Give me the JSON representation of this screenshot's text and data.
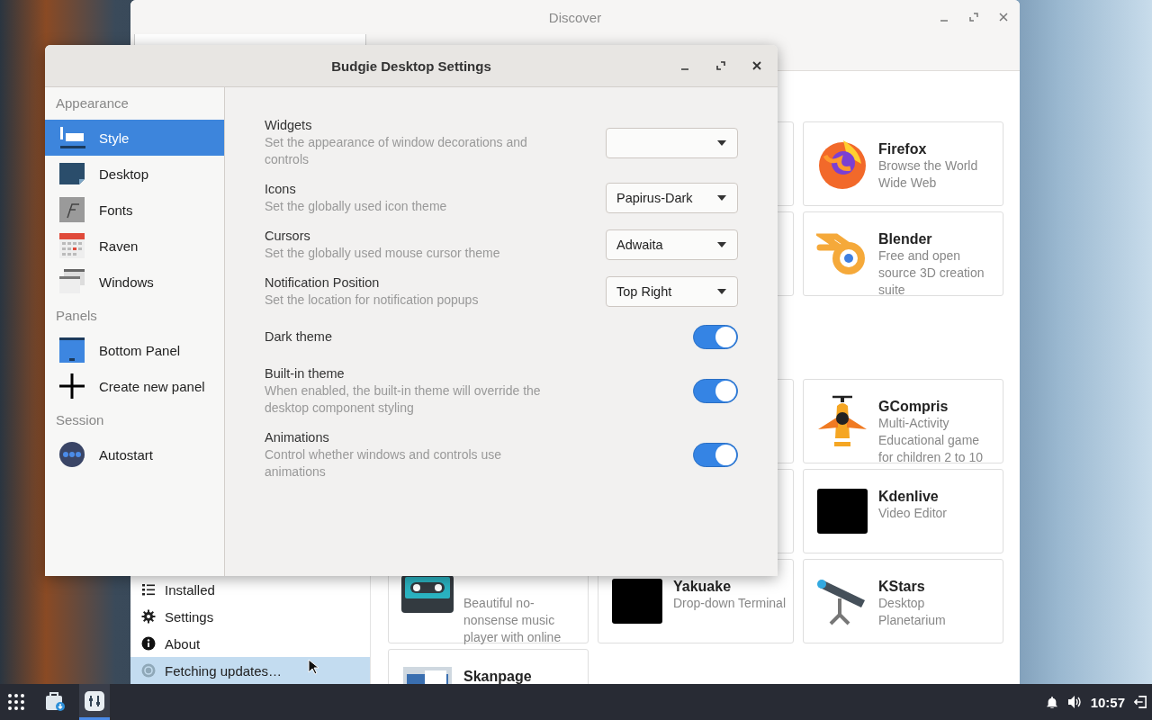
{
  "discover": {
    "title": "Discover",
    "sidebar": [
      {
        "label": "Installed",
        "selected": false
      },
      {
        "label": "Settings",
        "selected": false
      },
      {
        "label": "About",
        "selected": false
      },
      {
        "label": "Fetching updates…",
        "selected": true
      }
    ],
    "sections": [
      {
        "cards": [
          {
            "kind": "spacer"
          },
          {
            "kind": "blank"
          },
          {
            "kind": "app",
            "name": "Firefox",
            "description": "Browse the World Wide Web"
          },
          {
            "kind": "spacer"
          },
          {
            "kind": "blank"
          },
          {
            "kind": "app",
            "name": "Blender",
            "description": "Free and open source 3D creation suite"
          }
        ]
      },
      {
        "cards": [
          {
            "kind": "spacer"
          },
          {
            "kind": "blank"
          },
          {
            "kind": "app",
            "name": "GCompris",
            "description": "Multi-Activity Educational game for children 2 to 10"
          },
          {
            "kind": "spacer"
          },
          {
            "kind": "blank"
          },
          {
            "kind": "app",
            "name": "Kdenlive",
            "description": "Video Editor"
          },
          {
            "kind": "app",
            "description": "Beautiful no-nonsense music player with online"
          },
          {
            "kind": "app",
            "name": "Yakuake",
            "description": "Drop-down Terminal"
          },
          {
            "kind": "app",
            "name": "KStars",
            "description": "Desktop Planetarium"
          },
          {
            "kind": "app",
            "name": "Skanpage"
          }
        ]
      }
    ]
  },
  "settings_window": {
    "title": "Budgie Desktop Settings",
    "sidebar": [
      {
        "header": "Appearance",
        "items": [
          {
            "label": "Style",
            "selected": true
          },
          {
            "label": "Desktop",
            "selected": false
          },
          {
            "label": "Fonts",
            "selected": false
          },
          {
            "label": "Raven",
            "selected": false
          },
          {
            "label": "Windows",
            "selected": false
          }
        ]
      },
      {
        "header": "Panels",
        "items": [
          {
            "label": "Bottom Panel",
            "selected": false
          },
          {
            "label": "Create new panel",
            "selected": false
          }
        ]
      },
      {
        "header": "Session",
        "items": [
          {
            "label": "Autostart",
            "selected": false
          }
        ]
      }
    ],
    "settings": [
      {
        "kind": "dropdown",
        "label": "Widgets",
        "description": "Set the appearance of window decorations and controls"
      },
      {
        "kind": "dropdown",
        "label": "Icons",
        "description": "Set the globally used icon theme",
        "value": "Papirus-Dark"
      },
      {
        "kind": "dropdown",
        "label": "Cursors",
        "description": "Set the globally used mouse cursor theme",
        "value": "Adwaita"
      },
      {
        "kind": "dropdown",
        "label": "Notification Position",
        "description": "Set the location for notification popups",
        "value": "Top Right"
      },
      {
        "kind": "switch",
        "label": "Dark theme",
        "on": true
      },
      {
        "kind": "switch",
        "label": "Built-in theme",
        "description": "When enabled, the built-in theme will override the desktop component styling",
        "on": true
      },
      {
        "kind": "switch",
        "label": "Animations",
        "description": "Control whether windows and controls use animations",
        "on": true
      }
    ]
  },
  "taskbar": {
    "apps": [
      {
        "selected": false
      },
      {
        "selected": true
      }
    ],
    "clock": "10:57"
  }
}
